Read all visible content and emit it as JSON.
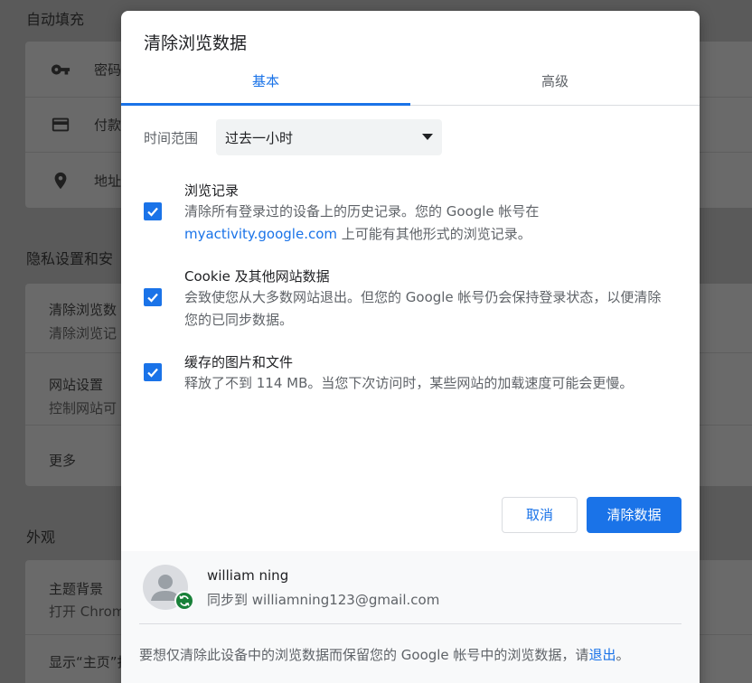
{
  "background": {
    "autofill_heading": "自动填充",
    "autofill_items": [
      "密码",
      "付款",
      "地址"
    ],
    "privacy_heading": "隐私设置和安",
    "privacy_items": [
      {
        "title": "清除浏览数",
        "sub": "清除浏览记"
      },
      {
        "title": "网站设置",
        "sub": "控制网站可"
      },
      {
        "title": "更多",
        "sub": ""
      }
    ],
    "appearance_heading": "外观",
    "appearance_items": [
      {
        "title": "主题背景",
        "sub": "打开 Chrom"
      },
      {
        "title": "显示“主页”打",
        "sub": ""
      }
    ]
  },
  "dialog": {
    "title": "清除浏览数据",
    "tabs": [
      {
        "label": "基本",
        "active": true
      },
      {
        "label": "高级",
        "active": false
      }
    ],
    "time_range": {
      "label": "时间范围",
      "value": "过去一小时"
    },
    "options": [
      {
        "title": "浏览记录",
        "checked": true,
        "desc_line1": "清除所有登录过的设备上的历史记录。您的 Google 帐号在",
        "desc_link": "myactivity.google.com",
        "desc_line2_rest": " 上可能有其他形式的浏览记录。"
      },
      {
        "title": "Cookie 及其他网站数据",
        "checked": true,
        "desc": "会致使您从大多数网站退出。但您的 Google 帐号仍会保持登录状态，以便清除您的已同步数据。"
      },
      {
        "title": "缓存的图片和文件",
        "checked": true,
        "desc": "释放了不到 114 MB。当您下次访问时，某些网站的加载速度可能会更慢。"
      }
    ],
    "buttons": {
      "cancel": "取消",
      "clear": "清除数据"
    },
    "account": {
      "name": "william ning",
      "sync_text": "同步到 williamning123@gmail.com"
    },
    "footer_note": {
      "text": "要想仅清除此设备中的浏览数据而保留您的 Google 帐号中的浏览数据，请",
      "link": "退出",
      "end": "。"
    }
  },
  "colors": {
    "accent": "#1a73e8",
    "sync_badge": "#188038",
    "overlay": "#5a5a5a"
  }
}
